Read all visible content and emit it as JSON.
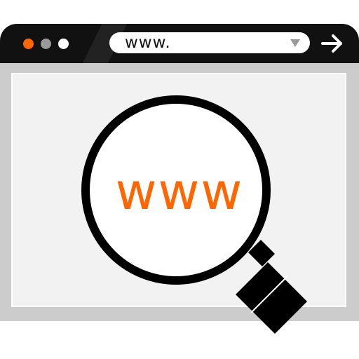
{
  "address_bar": {
    "value": "www."
  },
  "lens": {
    "text": "www"
  },
  "colors": {
    "titlebar": "#111111",
    "dot_close": "#ff6600",
    "dot_minimize": "#999999",
    "dot_maximize": "#ffffff",
    "frame": "#cccccc",
    "viewport": "#f2f2f2",
    "accent": "#ff6600"
  },
  "icons": [
    "dropdown-icon",
    "go-arrow-icon",
    "magnifier-icon"
  ]
}
